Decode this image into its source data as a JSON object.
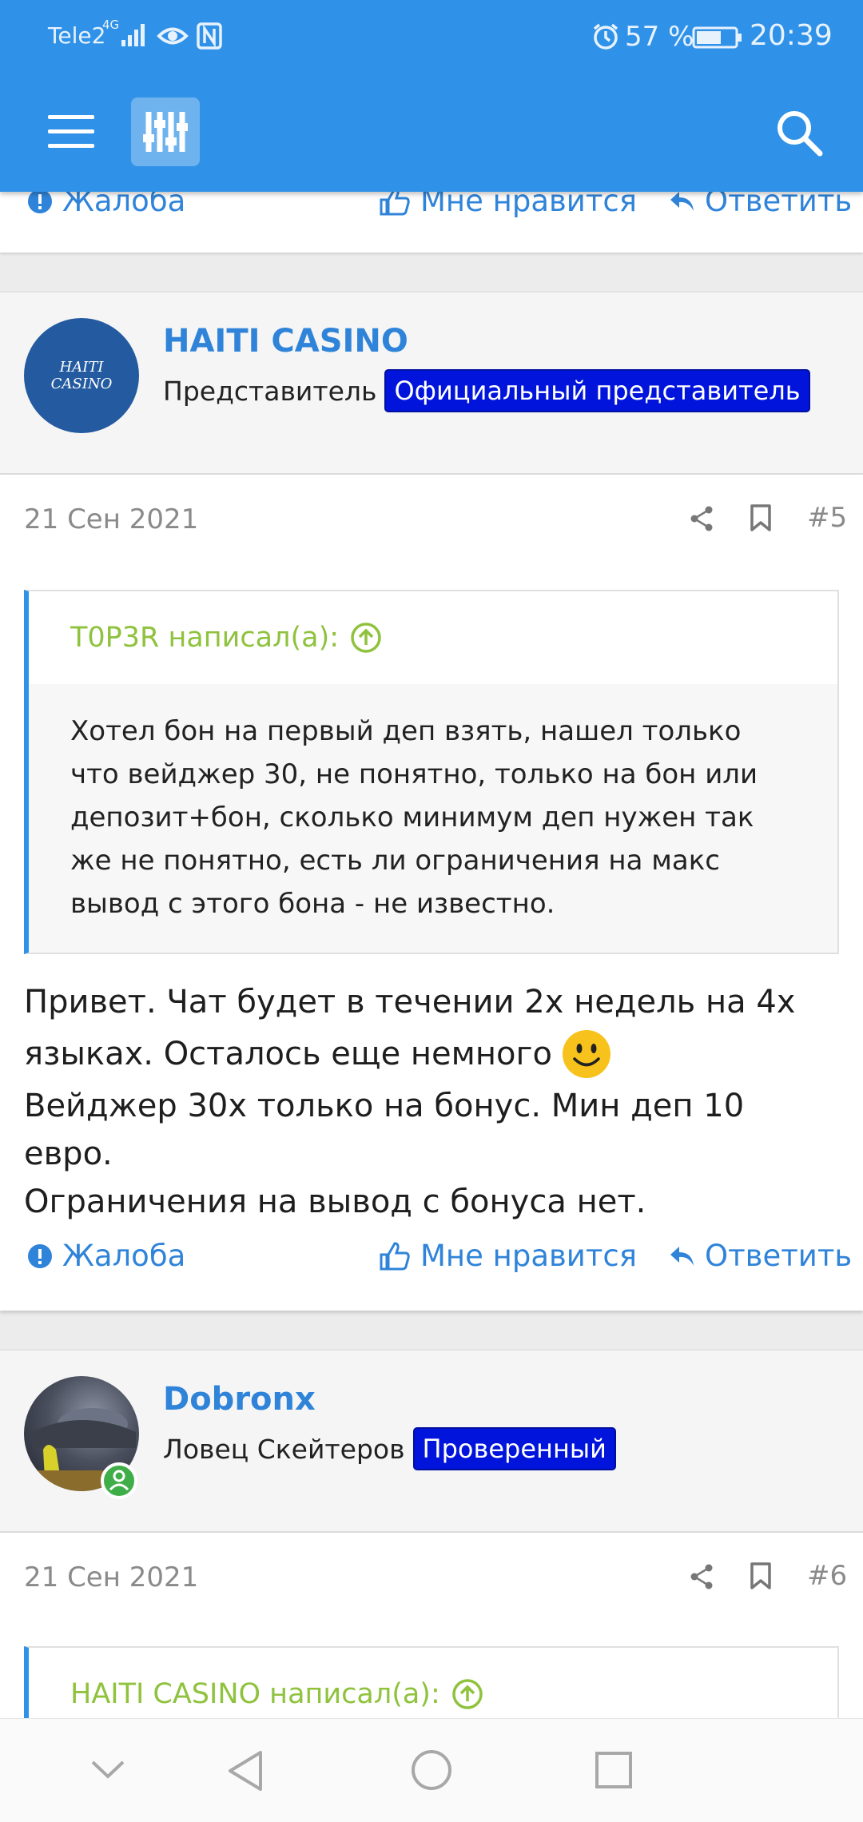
{
  "status_bar": {
    "carrier": "Tele2",
    "network": "4G",
    "battery_percent": "57 %",
    "time": "20:39",
    "icons": [
      "signal-icon",
      "eye-icon",
      "nfc-icon",
      "alarm-icon",
      "battery-icon"
    ]
  },
  "app_bar": {
    "icons": [
      "menu-icon",
      "filter-icon",
      "search-icon"
    ]
  },
  "actions": {
    "report": "Жалоба",
    "like": "Мне нравится",
    "reply": "Ответить"
  },
  "posts": [
    {
      "username": "HAITI CASINO",
      "avatar_text": "HAITI CASINO",
      "title": "Представитель",
      "badge": "Официальный представитель",
      "date": "21 Сен 2021",
      "number": "#5",
      "quote_author": "T0P3R написал(а):",
      "quote_lines": [
        "Хотел бон на первый деп взять, нашел только",
        "что вейджер 30, не понятно, только на бон или",
        "депозит+бон, сколько минимум деп нужен так",
        "же не понятно, есть ли ограничения на макс",
        "вывод с этого бона - не известно."
      ],
      "message_lines": [
        "Привет. Чат будет в течении 2х недель на 4х",
        "языках. Осталось еще немного",
        "Вейджер 30х только на бонус. Мин деп 10 евро.",
        "Ограничения на вывод с бонуса нет."
      ]
    },
    {
      "username": "Dobronx",
      "title": "Ловец Скейтеров",
      "badge": "Проверенный",
      "date": "21 Сен 2021",
      "number": "#6",
      "quote_author": "HAITI CASINO написал(а):"
    }
  ],
  "colors": {
    "app_bar": "#2f92e8",
    "link": "#2f84d9",
    "badge": "#0014dc",
    "quote_author": "#8fc23d",
    "online": "#3fae49"
  }
}
